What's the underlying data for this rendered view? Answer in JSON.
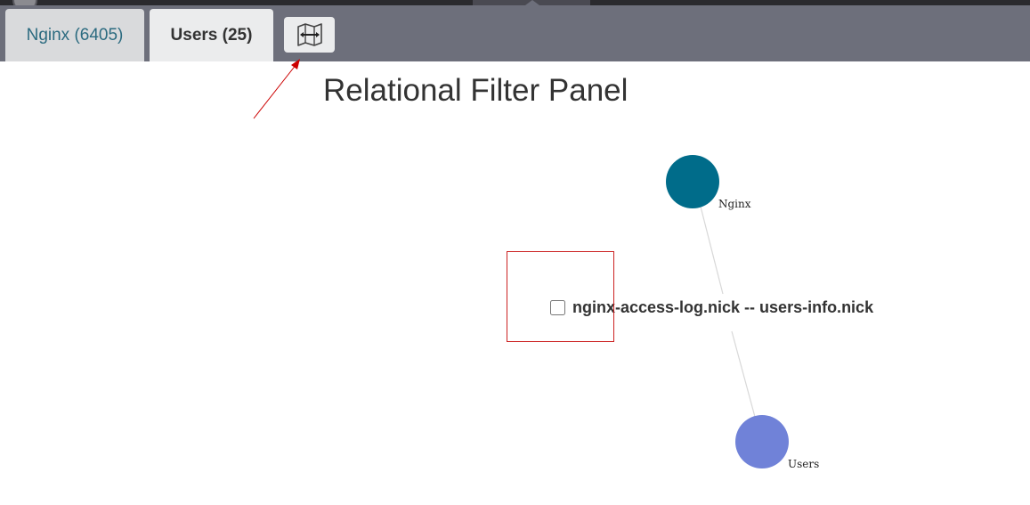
{
  "tabs": [
    {
      "label": "Nginx (6405)",
      "active": false
    },
    {
      "label": "Users (25)",
      "active": true
    }
  ],
  "toolbar": {
    "map_button_icon": "map-arrows-icon"
  },
  "panel": {
    "title": "Relational Filter Panel"
  },
  "graph": {
    "nodes": [
      {
        "label": "Nginx",
        "color": "#006c8a"
      },
      {
        "label": "Users",
        "color": "#7082d8"
      }
    ],
    "edge": {
      "label": "nginx-access-log.nick -- users-info.nick",
      "checked": false
    }
  },
  "annotations": {
    "arrow_color": "#cc0000",
    "box_color": "#cc2222"
  }
}
